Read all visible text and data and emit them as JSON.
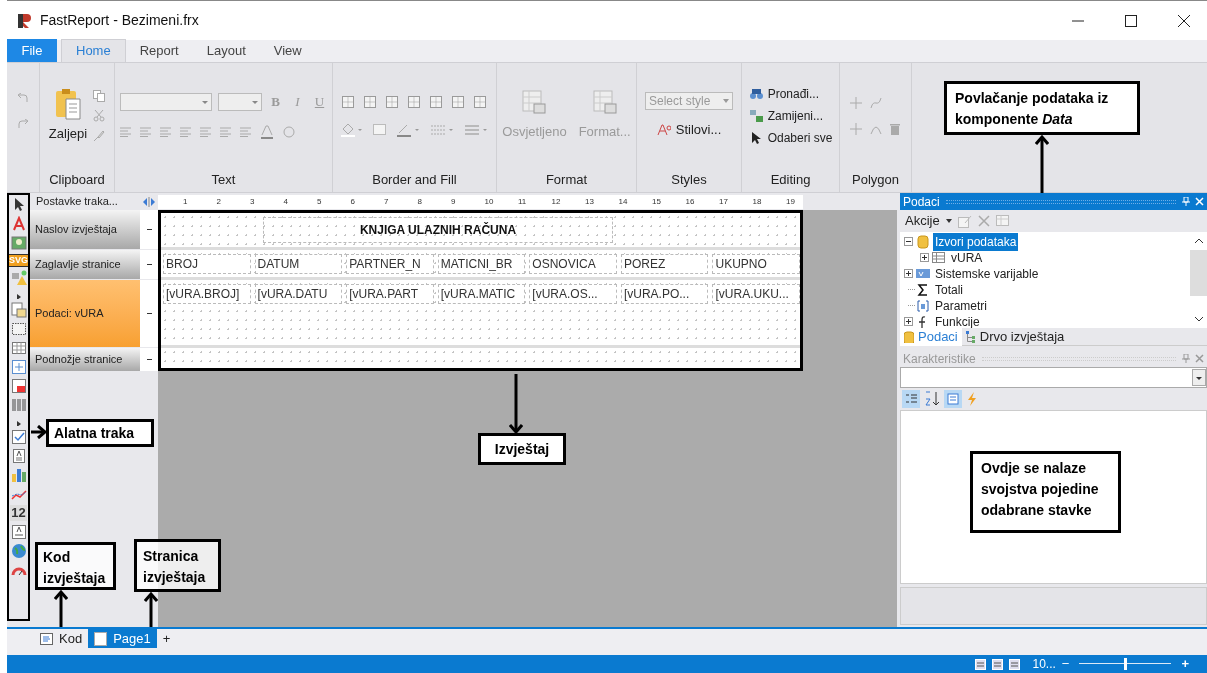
{
  "window": {
    "title": "FastReport - Bezimeni.frx"
  },
  "ribbon_tabs": [
    {
      "label": "File",
      "kind": "file"
    },
    {
      "label": "Home",
      "kind": "tab",
      "selected": true
    },
    {
      "label": "Report",
      "kind": "tab",
      "selected": false
    },
    {
      "label": "Layout",
      "kind": "tab",
      "selected": false
    },
    {
      "label": "View",
      "kind": "tab",
      "selected": false
    }
  ],
  "ribbon_groups": [
    {
      "label": "Clipboard",
      "kind": "clipboard",
      "buttons": [
        {
          "label": "Zaljepi",
          "disabled": false
        }
      ]
    },
    {
      "label": "Text",
      "kind": "text",
      "buttons": [
        {
          "label": "B",
          "disabled": true
        },
        {
          "label": "I",
          "disabled": true
        },
        {
          "label": "U",
          "disabled": true
        }
      ]
    },
    {
      "label": "Border and Fill",
      "kind": "border"
    },
    {
      "label": "Format",
      "kind": "format",
      "buttons": [
        {
          "label": "Osvjetljeno",
          "disabled": true
        },
        {
          "label": "Format...",
          "disabled": true
        }
      ]
    },
    {
      "label": "Styles",
      "kind": "styles",
      "placeholder": "Select style",
      "buttons": [
        {
          "label": "Stilovi...",
          "disabled": false
        }
      ]
    },
    {
      "label": "Editing",
      "kind": "editing",
      "buttons": [
        {
          "label": "Pronađi...",
          "disabled": false
        },
        {
          "label": "Zamijeni...",
          "disabled": false
        },
        {
          "label": "Odaberi sve",
          "disabled": false
        }
      ]
    },
    {
      "label": "Polygon",
      "kind": "polygon"
    }
  ],
  "toolbar": {
    "svg_label": "SVG",
    "number_label": "12"
  },
  "bands": {
    "settings": "Postavke traka...",
    "items": [
      {
        "label": "Naslov izvještaja",
        "selected": false
      },
      {
        "label": "Zaglavlje stranice",
        "selected": false
      },
      {
        "label": "Podaci: vURA",
        "selected": true
      },
      {
        "label": "Podnožje stranice",
        "selected": false
      }
    ]
  },
  "ruler": [
    "1",
    "2",
    "3",
    "4",
    "5",
    "6",
    "7",
    "8",
    "9",
    "10",
    "11",
    "12",
    "13",
    "14",
    "15",
    "16",
    "17",
    "18",
    "19"
  ],
  "report": {
    "title": "KNJIGA ULAZNIH RAČUNA",
    "header_cells": [
      "BROJ",
      "DATUM",
      "PARTNER_N",
      "MATICNI_BR",
      "OSNOVICA",
      "POREZ",
      "UKUPNO"
    ],
    "data_cells": [
      "[vURA.BROJ]",
      "[vURA.DATU",
      "[vURA.PART",
      "[vURA.MATIC",
      "[vURA.OS...",
      "[vURA.PO...",
      "[vURA.UKU..."
    ]
  },
  "data_panel": {
    "title": "Podaci",
    "actions": "Akcije",
    "tree": [
      {
        "label": "Izvori podataka",
        "kind": "datasource",
        "expanded": true,
        "selected": true,
        "children": [
          {
            "label": "vURA",
            "kind": "table",
            "expanded": false,
            "selected": false
          }
        ]
      },
      {
        "label": "Sistemske varijable",
        "kind": "variables",
        "expanded": false,
        "selected": false
      },
      {
        "label": "Totali",
        "kind": "totals",
        "selected": false
      },
      {
        "label": "Parametri",
        "kind": "parameters",
        "selected": false
      },
      {
        "label": "Funkcije",
        "kind": "functions",
        "expanded": false,
        "selected": false
      }
    ],
    "tabs": [
      {
        "label": "Podaci",
        "kind": "data",
        "selected": true
      },
      {
        "label": "Drvo izvještaja",
        "kind": "tree",
        "selected": false
      }
    ]
  },
  "properties_panel": {
    "title": "Karakteristike"
  },
  "page_tabs": [
    {
      "label": "Kod",
      "kind": "code",
      "selected": false
    },
    {
      "label": "Page1",
      "kind": "page",
      "selected": true
    }
  ],
  "add_page": "+",
  "status_bar": {
    "zoom": "10...",
    "minus": "−",
    "plus": "+",
    "level": 0.5
  },
  "annotations": [
    {
      "text": "Povlačanje podataka iz komponente *Data*",
      "kind": "data"
    },
    {
      "text": "Alatna traka",
      "kind": "toolbar"
    },
    {
      "text": "Izvještaj",
      "kind": "report"
    },
    {
      "text": "Ovdje se nalaze svojstva pojedine odabrane stavke",
      "kind": "properties"
    },
    {
      "text": "Kod izvještaja",
      "kind": "code"
    },
    {
      "text": "Stranica izvještaja",
      "kind": "page"
    }
  ]
}
